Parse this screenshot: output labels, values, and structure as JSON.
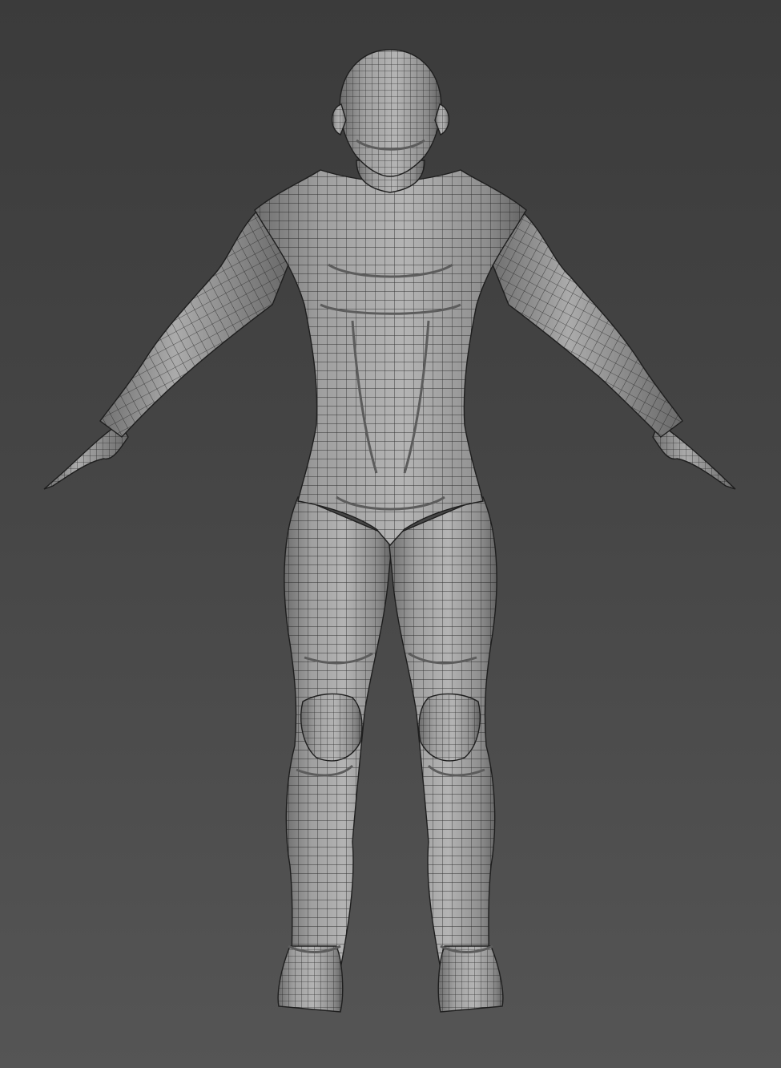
{
  "viewport": {
    "background_top": "#3b3b3b",
    "background_bottom": "#555555"
  },
  "model": {
    "fill": "#9a9a9a",
    "shadow": "#5c5c5c",
    "wire": "#1e1e1e",
    "pose": "a-pose",
    "view": "front"
  }
}
